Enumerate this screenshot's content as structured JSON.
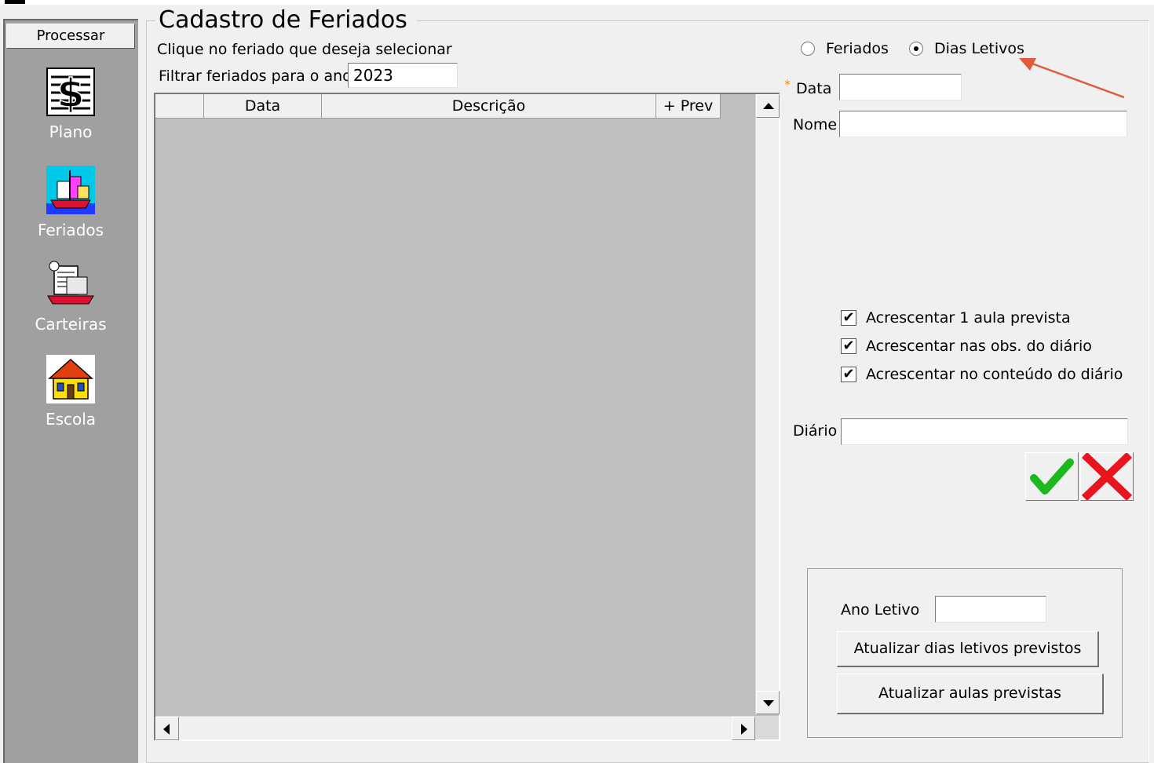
{
  "sidebar": {
    "process_label": "Processar",
    "items": [
      {
        "label": "Plano",
        "icon": "dollar-document-icon"
      },
      {
        "label": "Feriados",
        "icon": "calendar-ship-icon"
      },
      {
        "label": "Carteiras",
        "icon": "school-desk-icon"
      },
      {
        "label": "Escola",
        "icon": "school-house-icon"
      }
    ]
  },
  "main": {
    "title": "Cadastro de Feriados",
    "instruction": "Clique no feriado que deseja selecionar",
    "filter_label": "Filtrar feriados para o ano",
    "filter_value": "2023",
    "grid": {
      "columns": [
        "",
        "Data",
        "Descrição",
        "+ Prev"
      ]
    }
  },
  "form": {
    "radio_options": [
      {
        "label": "Feriados",
        "selected": false
      },
      {
        "label": "Dias Letivos",
        "selected": true
      }
    ],
    "required_marker": "*",
    "data_label": "Data",
    "data_value": "",
    "nome_label": "Nome",
    "nome_value": "",
    "checkboxes": [
      {
        "label": "Acrescentar 1 aula prevista",
        "checked": true
      },
      {
        "label": "Acrescentar nas obs. do diário",
        "checked": true
      },
      {
        "label": "Acrescentar no conteúdo do diário",
        "checked": true
      }
    ],
    "diario_label": "Diário",
    "diario_value": "",
    "confirm_icon": "green-checkmark-icon",
    "cancel_icon": "red-x-icon"
  },
  "ano_letivo": {
    "label": "Ano Letivo",
    "value": "",
    "btn_dias": "Atualizar dias letivos previstos",
    "btn_aulas": "Atualizar aulas previstas"
  },
  "colors": {
    "sidebar_bg": "#a0a0a0",
    "grid_bg": "#bfbfbf",
    "annotation_arrow": "#e05a3c",
    "confirm_green": "#1db81d",
    "cancel_red": "#e8141e"
  }
}
